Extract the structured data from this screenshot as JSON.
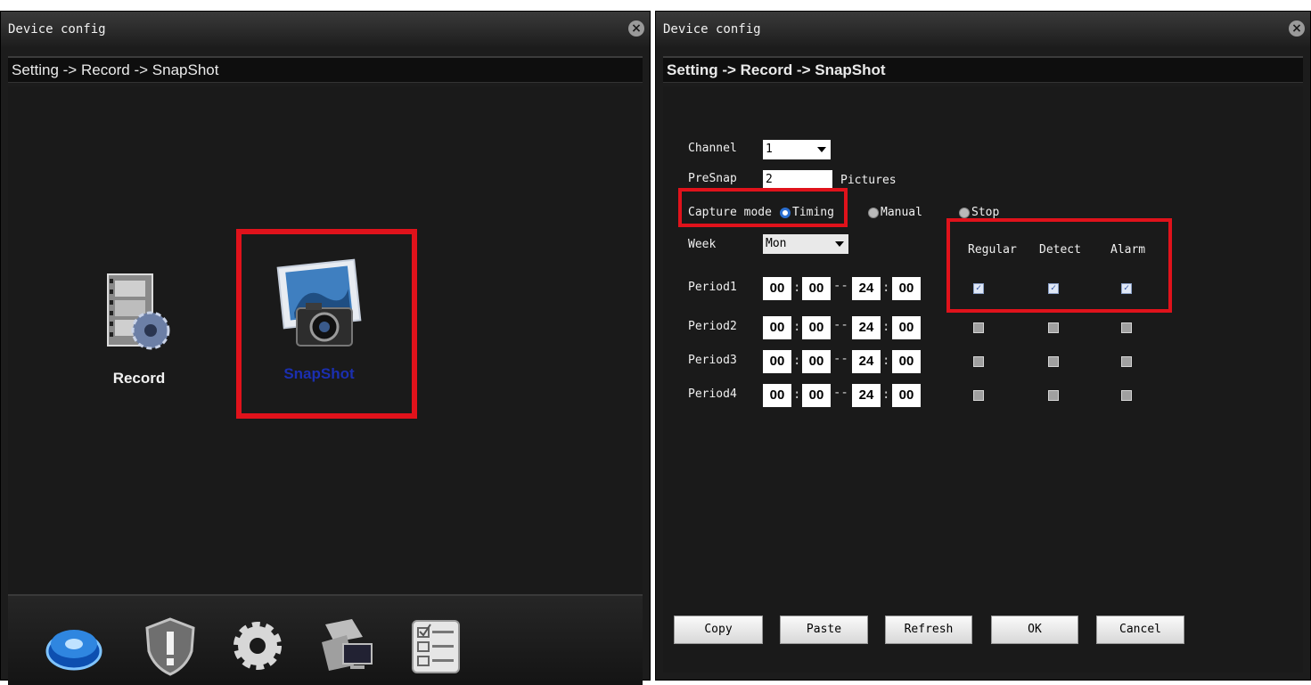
{
  "left_window": {
    "title": "Device config",
    "breadcrumb": "Setting -> Record -> SnapShot",
    "tiles": [
      {
        "label": "Record",
        "icon": "film-gear-icon"
      },
      {
        "label": "SnapShot",
        "icon": "camera-photo-icon"
      }
    ],
    "nav_icons": [
      "disk-icon",
      "shield-alert-icon",
      "gear-icon",
      "network-computer-icon",
      "checklist-icon"
    ]
  },
  "right_window": {
    "title": "Device config",
    "breadcrumb": "Setting -> Record -> SnapShot",
    "channel": {
      "label": "Channel",
      "value": "1"
    },
    "presnap": {
      "label": "PreSnap",
      "value": "2",
      "unit": "Pictures"
    },
    "capture_mode": {
      "label": "Capture mode",
      "options": [
        {
          "label": "Timing",
          "selected": true
        },
        {
          "label": "Manual",
          "selected": false
        },
        {
          "label": "Stop",
          "selected": false
        }
      ]
    },
    "week": {
      "label": "Week",
      "value": "Mon"
    },
    "columns": [
      "Regular",
      "Detect",
      "Alarm"
    ],
    "periods": [
      {
        "label": "Period1",
        "start_h": "00",
        "start_m": "00",
        "end_h": "24",
        "end_m": "00",
        "regular": true,
        "detect": true,
        "alarm": true
      },
      {
        "label": "Period2",
        "start_h": "00",
        "start_m": "00",
        "end_h": "24",
        "end_m": "00",
        "regular": false,
        "detect": false,
        "alarm": false
      },
      {
        "label": "Period3",
        "start_h": "00",
        "start_m": "00",
        "end_h": "24",
        "end_m": "00",
        "regular": false,
        "detect": false,
        "alarm": false
      },
      {
        "label": "Period4",
        "start_h": "00",
        "start_m": "00",
        "end_h": "24",
        "end_m": "00",
        "regular": false,
        "detect": false,
        "alarm": false
      }
    ],
    "buttons": {
      "copy": "Copy",
      "paste": "Paste",
      "refresh": "Refresh",
      "ok": "OK",
      "cancel": "Cancel"
    }
  },
  "colors": {
    "highlight": "#e0121b",
    "snapshot_label": "#1b2fb0"
  }
}
